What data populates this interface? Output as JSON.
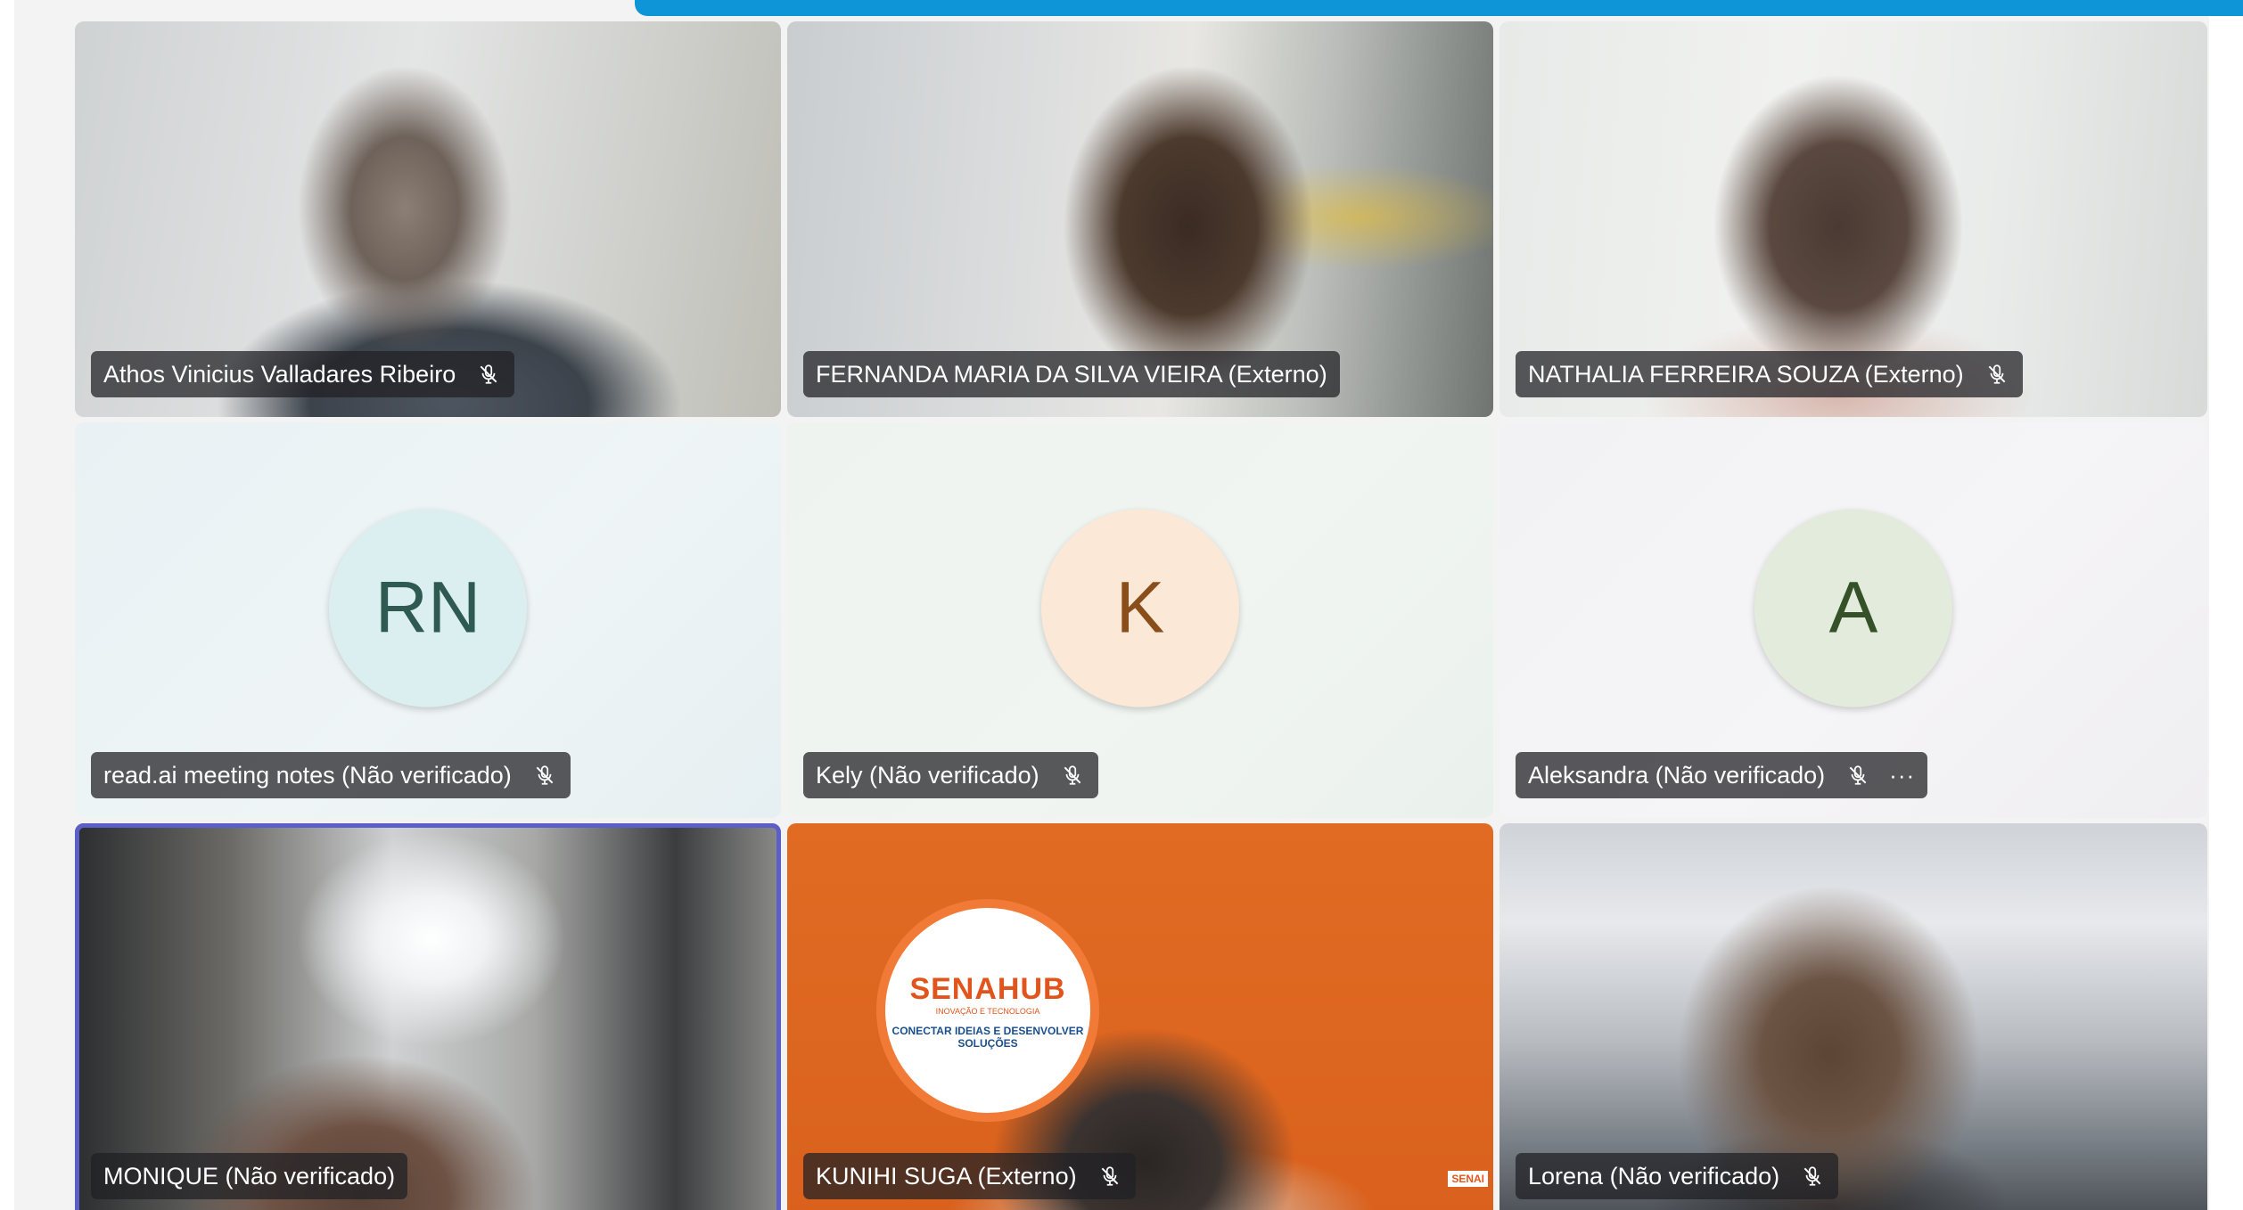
{
  "participants": [
    {
      "name": "Athos Vinicius Valladares Ribeiro",
      "muted": true,
      "more": false
    },
    {
      "name": "FERNANDA MARIA DA SILVA VIEIRA (Externo)",
      "muted": false,
      "more": false
    },
    {
      "name": "NATHALIA FERREIRA SOUZA (Externo)",
      "muted": true,
      "more": false
    },
    {
      "name": "read.ai meeting notes (Não verificado)",
      "initials": "RN",
      "muted": true,
      "more": false
    },
    {
      "name": "Kely (Não verificado)",
      "initials": "K",
      "muted": true,
      "more": false
    },
    {
      "name": "Aleksandra (Não verificado)",
      "initials": "A",
      "muted": true,
      "more": true,
      "more_glyph": "···"
    },
    {
      "name": "MONIQUE (Não verificado)",
      "muted": false,
      "more": false
    },
    {
      "name": "KUNIHI SUGA (Externo)",
      "muted": true,
      "more": false
    },
    {
      "name": "Lorena (Não verificado)",
      "muted": true,
      "more": false
    }
  ],
  "kunihi_background": {
    "brand": "SENAHUB",
    "brand_sub": "INOVAÇÃO E TECNOLOGIA",
    "tagline": "CONECTAR IDEIAS E DESENVOLVER SOLUÇÕES",
    "corner_mark": "SENAI"
  },
  "colors": {
    "accent_bar": "#0e95d8",
    "selected_outline": "#5b5fc7",
    "nameplate_bg": "rgba(32,32,36,0.74)"
  },
  "icons": {
    "mic_muted": "mic-off-icon",
    "more": "more-options-icon"
  }
}
